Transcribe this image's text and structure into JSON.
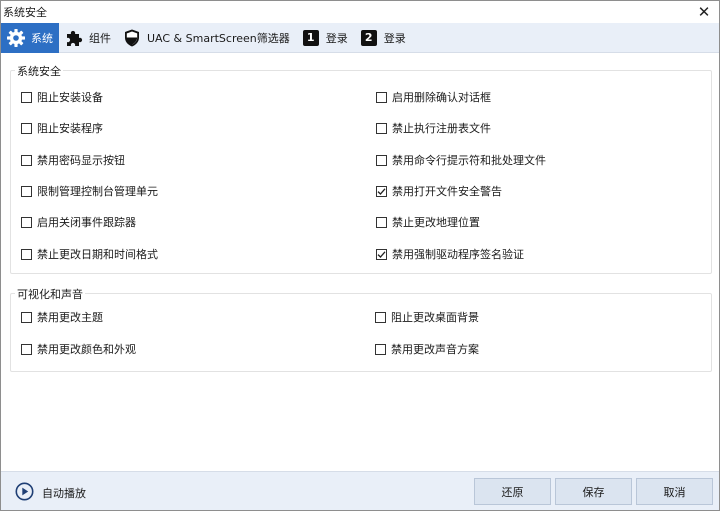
{
  "window": {
    "title": "系统安全",
    "close_glyph": "✕"
  },
  "tabs": [
    {
      "label": "系统",
      "icon": "gear-icon"
    },
    {
      "label": "组件",
      "icon": "puzzle-icon"
    },
    {
      "label": "UAC & SmartScreen筛选器",
      "icon": "shield-icon"
    },
    {
      "label": "登录",
      "icon": "number-1-icon",
      "num": "1"
    },
    {
      "label": "登录",
      "icon": "number-2-icon",
      "num": "2"
    }
  ],
  "groups": {
    "system_security": {
      "label": "系统安全",
      "left": [
        {
          "label": "阻止安装设备",
          "checked": false
        },
        {
          "label": "阻止安装程序",
          "checked": false
        },
        {
          "label": "禁用密码显示按钮",
          "checked": false
        },
        {
          "label": "限制管理控制台管理单元",
          "checked": false
        },
        {
          "label": "启用关闭事件跟踪器",
          "checked": false
        },
        {
          "label": "禁止更改日期和时间格式",
          "checked": false
        }
      ],
      "right": [
        {
          "label": "启用删除确认对话框",
          "checked": false
        },
        {
          "label": "禁止执行注册表文件",
          "checked": false
        },
        {
          "label": "禁用命令行提示符和批处理文件",
          "checked": false
        },
        {
          "label": "禁用打开文件安全警告",
          "checked": true
        },
        {
          "label": "禁止更改地理位置",
          "checked": false
        },
        {
          "label": "禁用强制驱动程序签名验证",
          "checked": true
        }
      ]
    },
    "visual_sound": {
      "label": "可视化和声音",
      "left": [
        {
          "label": "禁用更改主题",
          "checked": false
        },
        {
          "label": "禁用更改颜色和外观",
          "checked": false
        }
      ],
      "right": [
        {
          "label": "阻止更改桌面背景",
          "checked": false
        },
        {
          "label": "禁用更改声音方案",
          "checked": false
        }
      ]
    }
  },
  "footer": {
    "autoplay_label": "自动播放",
    "restore_label": "还原",
    "save_label": "保存",
    "cancel_label": "取消"
  },
  "colors": {
    "accent": "#2d6fc4",
    "bar": "#e9eff8",
    "button": "#dbe4f0"
  }
}
